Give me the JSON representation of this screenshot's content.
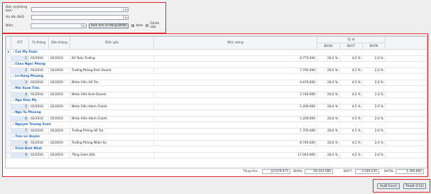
{
  "filters": {
    "department_label": "Đơn vị/phòng ban:",
    "department_value": "",
    "employee_label": "Họ tên NLĐ",
    "employee_value": "",
    "year_label": "Năm",
    "year_value": "",
    "view_history_button": "Xem lịch sử đóng BHXH",
    "radio_view": "Xem",
    "radio_edit": "Chỉnh sửa",
    "selected_mode": "Xem"
  },
  "table": {
    "headers": {
      "stt": "STT",
      "from_month": "Từ tháng",
      "to_month": "Đến tháng",
      "description": "Diễn giải",
      "salary": "Mức lương",
      "rate_group": "Tỷ lệ",
      "bhxh": "BHXH",
      "bhyt": "BHYT",
      "bhtn": "BHTN"
    },
    "groups": [
      {
        "name": ": Cao My Xuan",
        "rows": [
          {
            "stt": "1",
            "from": "02/2016",
            "to": "02/2016",
            "desc": "Kế Toán Trưởng",
            "salary": "9.775.000",
            "bhxh": "26,0 %",
            "bhyt": "4,5 %",
            "bhtn": "2,0 %"
          }
        ]
      },
      {
        "name": ": Chau Ngoc Phong",
        "rows": [
          {
            "stt": "2",
            "from": "02/2016",
            "to": "02/2016",
            "desc": "Trưởng Phòng Kinh Doanh",
            "salary": "7.705.000",
            "bhxh": "26,0 %",
            "bhyt": "4,5 %",
            "bhtn": "2,0 %"
          }
        ]
      },
      {
        "name": ": Le Hung Phuong",
        "rows": [
          {
            "stt": "3",
            "from": "02/2016",
            "to": "02/2016",
            "desc": "Nhân Viên Hỗ Trợ",
            "salary": "4.670.000",
            "bhxh": "26,0 %",
            "bhyt": "4,5 %",
            "bhtn": "2,0 %"
          }
        ]
      },
      {
        "name": ": Mai Xuan Tien",
        "rows": [
          {
            "stt": "4",
            "from": "02/2016",
            "to": "02/2016",
            "desc": "Nhân Viên Kinh Doanh",
            "salary": "3.740.000",
            "bhxh": "26,0 %",
            "bhyt": "4,5 %",
            "bhtn": "2,0 %"
          }
        ]
      },
      {
        "name": ": Ngo Kieu My",
        "rows": [
          {
            "stt": "5",
            "from": "02/2016",
            "to": "02/2016",
            "desc": "Nhân Viên Hành Chánh",
            "salary": "5.200.000",
            "bhxh": "26,0 %",
            "bhyt": "4,5 %",
            "bhtn": "2,0 %"
          }
        ]
      },
      {
        "name": ": Ngo Tu Phuong",
        "rows": [
          {
            "stt": "6",
            "from": "02/2016",
            "to": "02/2016",
            "desc": "Nhân Viên Hành Chánh",
            "salary": "5.200.000",
            "bhxh": "26,0 %",
            "bhyt": "4,5 %",
            "bhtn": "2,0 %"
          }
        ]
      },
      {
        "name": ": Nguyen Truong Xuan",
        "rows": [
          {
            "stt": "7",
            "from": "02/2016",
            "to": "02/2016",
            "desc": "Trưởng Phòng Hỗ Trợ",
            "salary": "7.705.000",
            "bhxh": "26,0 %",
            "bhyt": "4,5 %",
            "bhtn": "2,0 %"
          }
        ]
      },
      {
        "name": ": Tran Le Quyen",
        "rows": [
          {
            "stt": "8",
            "from": "02/2016",
            "to": "02/2016",
            "desc": "Trưởng Phòng Nhân Sự",
            "salary": "8.740.000",
            "bhxh": "26,0 %",
            "bhyt": "4,5 %",
            "bhtn": "2,0 %"
          }
        ]
      },
      {
        "name": ": Trinh Binh Minh",
        "rows": [
          {
            "stt": "9",
            "from": "02/2016",
            "to": "02/2016",
            "desc": "Tổng Giám Đốc",
            "salary": "17.043.000",
            "bhxh": "26,0 %",
            "bhyt": "4,5 %",
            "bhtn": "2,0 %"
          }
        ]
      }
    ]
  },
  "totals": {
    "total_label": "Tổng tiền:",
    "total_value": "22.679.475",
    "bhxh_label": "BHXH:",
    "bhxh_value": "18.143.580",
    "bhyt_label": "BHYT:",
    "bhyt_value": "3.140.235",
    "bhtn_label": "BHTN:",
    "bhtn_value": "1.395.660"
  },
  "actions": {
    "export_excel": "Xuất Excel",
    "exit": "Thoát (F12)"
  },
  "colors": {
    "highlight_border": "#e0242b",
    "group_text": "#1b62b7"
  }
}
